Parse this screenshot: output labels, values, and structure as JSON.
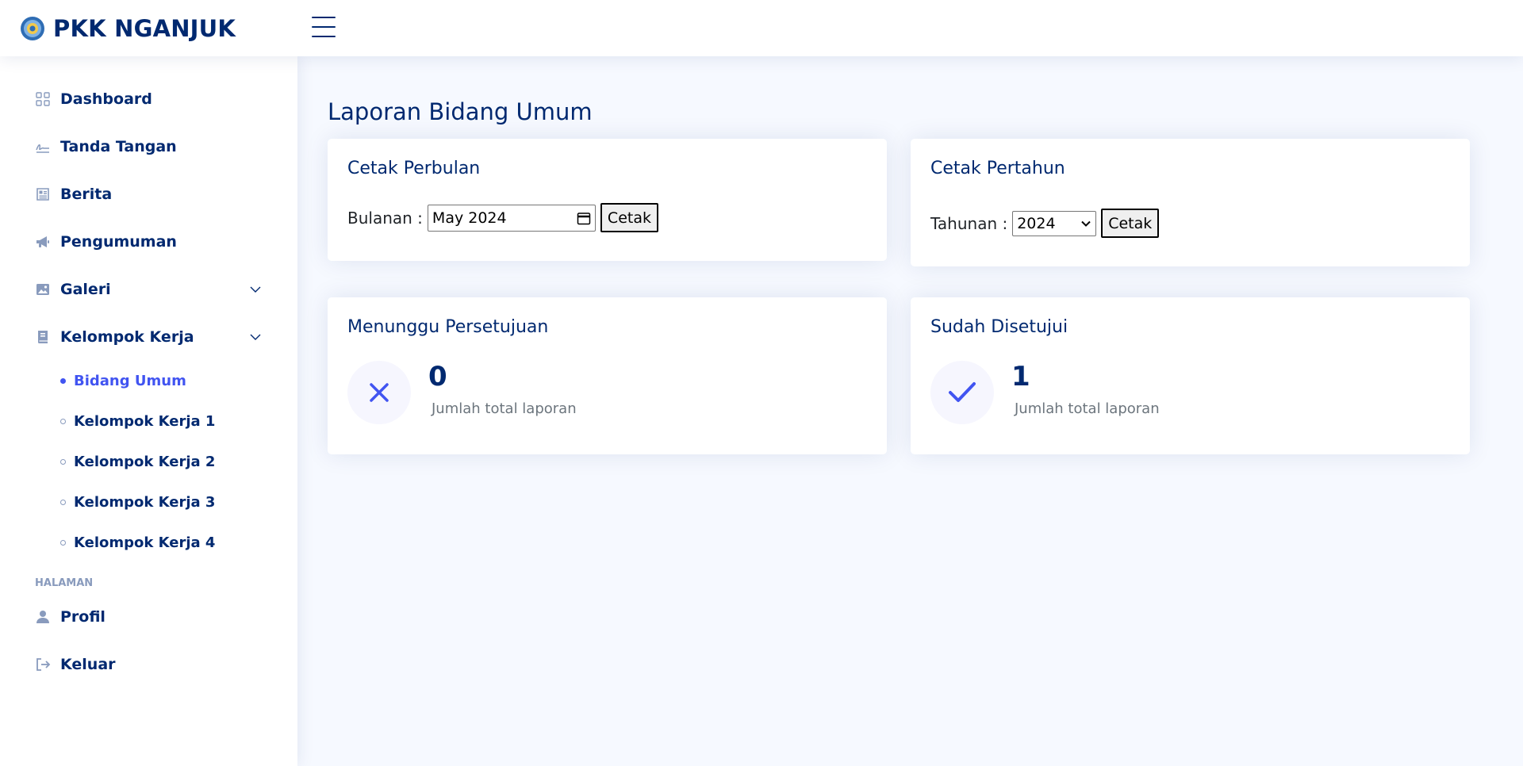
{
  "header": {
    "logo_text": "PKK NGANJUK"
  },
  "sidebar": {
    "items": [
      {
        "label": "Dashboard",
        "icon": "grid-icon"
      },
      {
        "label": "Tanda Tangan",
        "icon": "signature-icon"
      },
      {
        "label": "Berita",
        "icon": "newspaper-icon"
      },
      {
        "label": "Pengumuman",
        "icon": "megaphone-icon"
      },
      {
        "label": "Galeri",
        "icon": "image-icon"
      },
      {
        "label": "Kelompok Kerja",
        "icon": "book-icon"
      }
    ],
    "sub_items": [
      {
        "label": "Bidang Umum",
        "active": true
      },
      {
        "label": "Kelompok Kerja 1"
      },
      {
        "label": "Kelompok Kerja 2"
      },
      {
        "label": "Kelompok Kerja 3"
      },
      {
        "label": "Kelompok Kerja 4"
      }
    ],
    "section_heading": "HALAMAN",
    "page_items": [
      {
        "label": "Profil",
        "icon": "person-icon"
      },
      {
        "label": "Keluar",
        "icon": "logout-icon"
      }
    ]
  },
  "main": {
    "page_title": "Laporan Bidang Umum",
    "monthly": {
      "title": "Cetak Perbulan",
      "label": "Bulanan :",
      "value": "May 2024",
      "button": "Cetak"
    },
    "yearly": {
      "title": "Cetak Pertahun",
      "label": "Tahunan :",
      "value": "2024",
      "button": "Cetak"
    },
    "pending": {
      "title": "Menunggu Persetujuan",
      "count": "0",
      "caption": "Jumlah total laporan"
    },
    "approved": {
      "title": "Sudah Disetujui",
      "count": "1",
      "caption": "Jumlah total laporan"
    }
  },
  "colors": {
    "primary": "#012970",
    "accent": "#4154f1",
    "muted": "#899bbd",
    "background": "#f6f9ff"
  }
}
